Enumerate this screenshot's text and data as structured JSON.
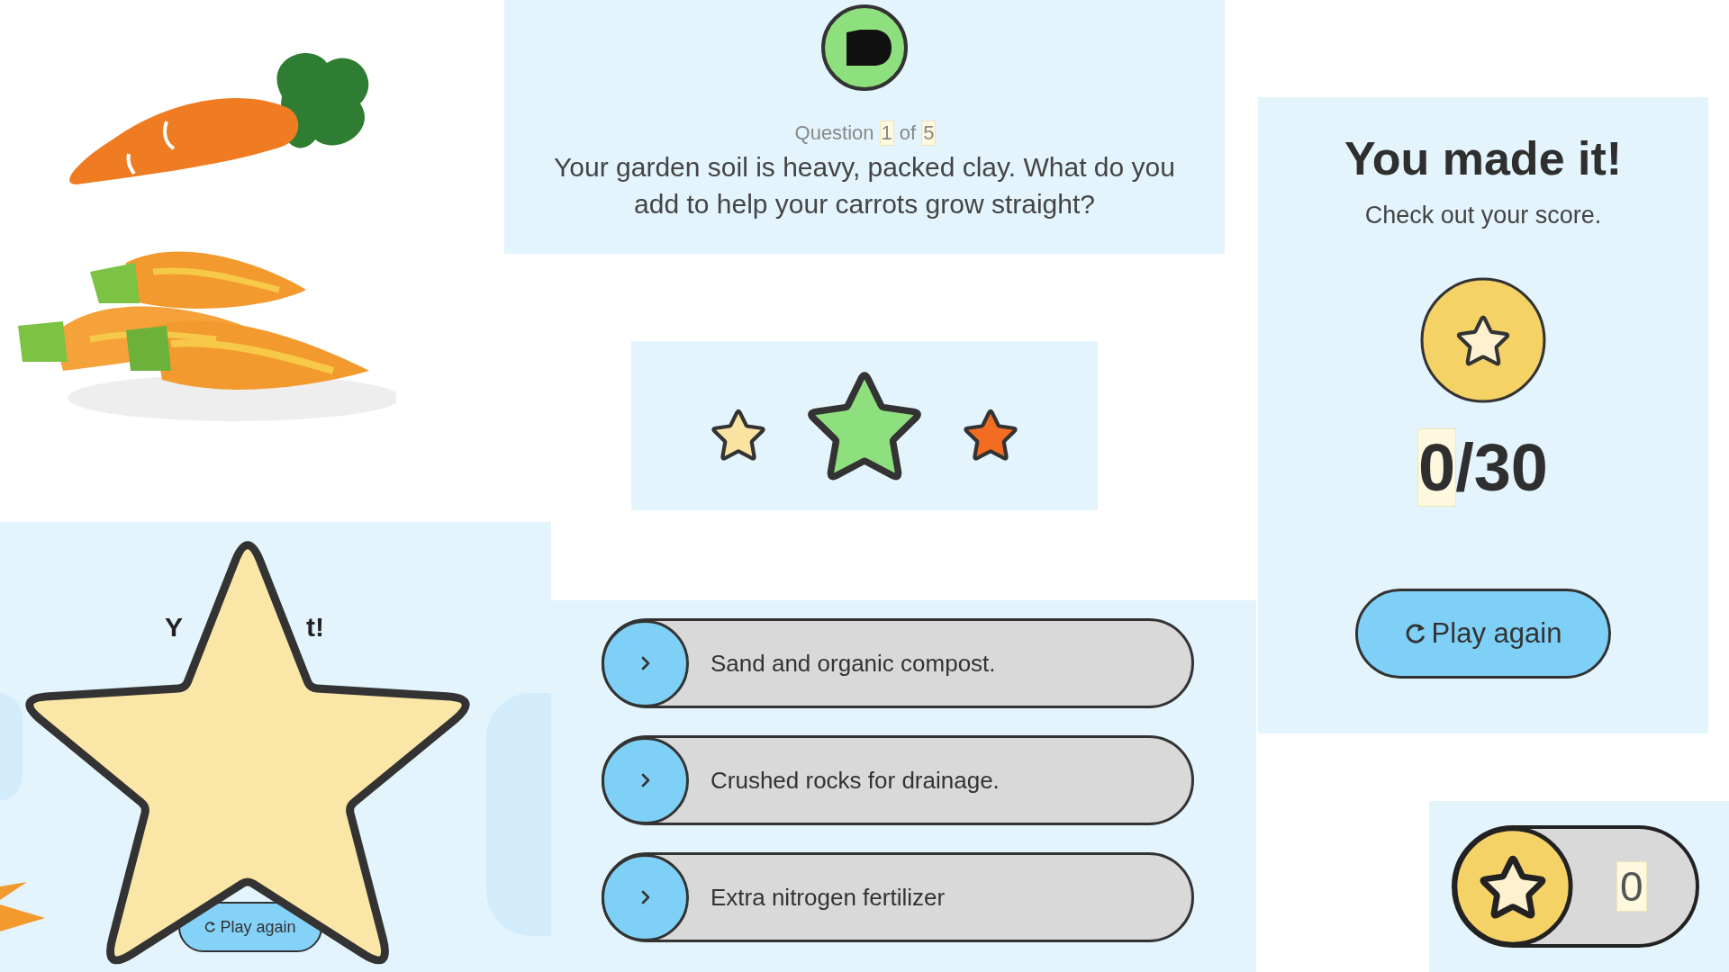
{
  "question_card": {
    "label": [
      {
        "text": "Question",
        "highlighted": false
      },
      {
        "text": "1",
        "highlighted": true
      },
      {
        "text": "of",
        "highlighted": false
      },
      {
        "text": "5",
        "highlighted": true
      }
    ],
    "question": "Your garden soil is heavy, packed clay. What do you add to help your carrots grow straight?"
  },
  "star_row": [
    {
      "kind": "small",
      "color": "#f8e3a0"
    },
    {
      "kind": "large",
      "color": "#8ee07e"
    },
    {
      "kind": "small",
      "color": "#f26d21"
    }
  ],
  "covered_result_card": {
    "title_fragments": [
      "Y",
      "t!"
    ],
    "button": "Play again"
  },
  "answers": [
    "Sand and organic compost.",
    "Crushed rocks for drainage.",
    "Extra nitrogen fertilizer"
  ],
  "result_card": {
    "title": "You made it!",
    "subtitle": "Check out your score.",
    "score": [
      {
        "text": "0",
        "highlighted": true
      },
      {
        "text": "/30",
        "highlighted": false
      }
    ],
    "button": "Play again"
  },
  "score_pill": {
    "value": "0",
    "highlighted": true
  }
}
